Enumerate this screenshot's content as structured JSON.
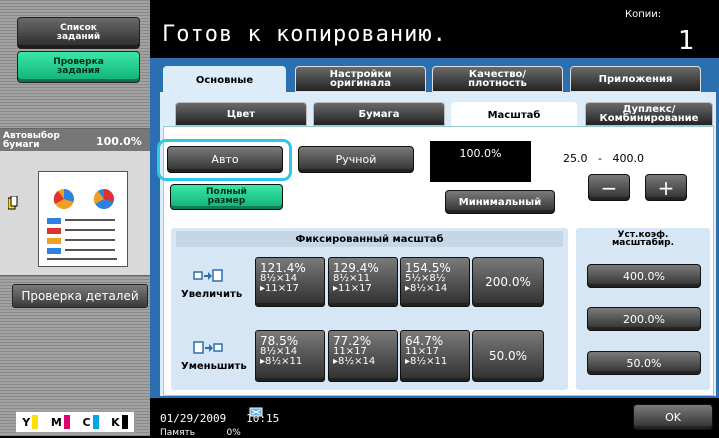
{
  "sidebar": {
    "jobs_button": "Список\nзаданий",
    "check_button": "Проверка\nзадания",
    "paper_label": "Автовыбор\nбумаги",
    "paper_value": "100.0%",
    "details_button": "Проверка деталей",
    "toner": [
      "Y",
      "M",
      "C",
      "K"
    ]
  },
  "header": {
    "status": "Готов к копированию.",
    "copies_label": "Копии:",
    "copies_value": "1"
  },
  "tabs": {
    "main": "Основные",
    "original": "Настройки\nоригинала",
    "quality": "Качество/\nплотность",
    "apps": "Приложения"
  },
  "subtabs": {
    "color": "Цвет",
    "paper": "Бумага",
    "zoom": "Масштаб",
    "duplex": "Дуплекс/\nКомбинирование"
  },
  "zoom": {
    "auto": "Авто",
    "manual": "Ручной",
    "full_size": "Полный\nразмер",
    "current": "100.0%",
    "minimal": "Минимальный",
    "range_min": "25.0",
    "range_dash": "-",
    "range_max": "400.0",
    "minus": "−",
    "plus": "+"
  },
  "fixed": {
    "header": "Фиксированный масштаб",
    "enlarge_label": "Увеличить",
    "reduce_label": "Уменьшить",
    "enlarge": [
      {
        "pct": "121.4%",
        "l1": "8½×14",
        "l2": "▸11×17"
      },
      {
        "pct": "129.4%",
        "l1": "8½×11",
        "l2": "▸11×17"
      },
      {
        "pct": "154.5%",
        "l1": "5½×8½",
        "l2": "▸8½×14"
      }
    ],
    "enlarge_big": "200.0%",
    "reduce": [
      {
        "pct": "78.5%",
        "l1": "8½×14",
        "l2": "▸8½×11"
      },
      {
        "pct": "77.2%",
        "l1": "11×17",
        "l2": "▸8½×14"
      },
      {
        "pct": "64.7%",
        "l1": "11×17",
        "l2": "▸8½×11"
      }
    ],
    "reduce_big": "50.0%"
  },
  "user_zoom": {
    "header": "Уст.коэф.\nмасштабир.",
    "values": [
      "400.0%",
      "200.0%",
      "50.0%"
    ]
  },
  "footer": {
    "date": "01/29/2009",
    "time": "10:15",
    "memory_label": "Память",
    "memory_value": "0%",
    "ok": "OK"
  }
}
